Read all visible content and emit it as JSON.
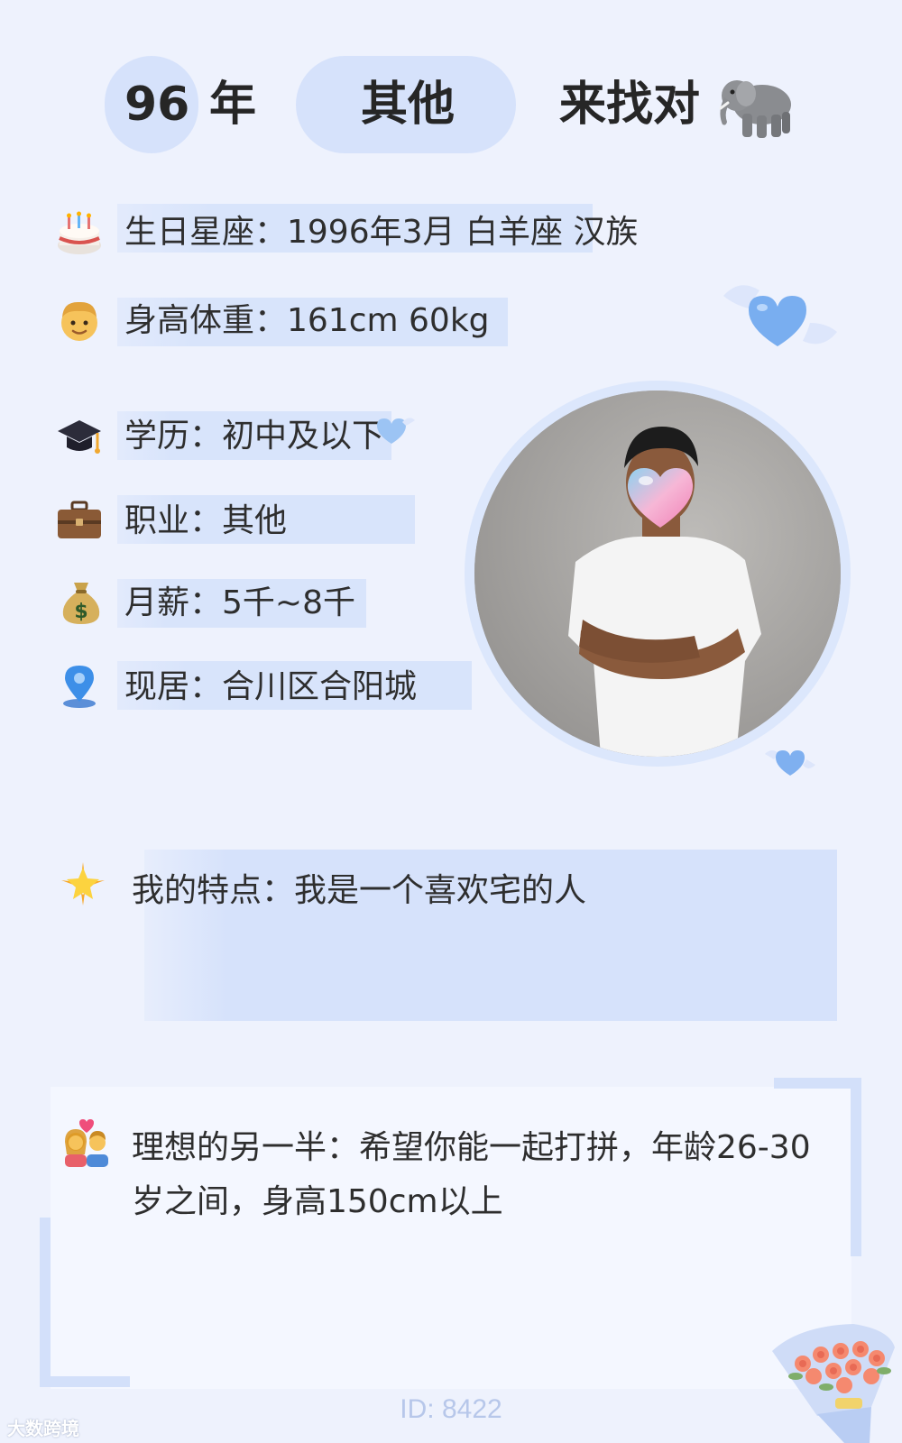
{
  "header": {
    "age_number": "96",
    "age_unit": "年",
    "category": "其他",
    "seeking": "来找对",
    "seeking_icon": "elephant-icon"
  },
  "info": {
    "birthday": {
      "icon": "birthday-cake-icon",
      "text": "生日星座：1996年3月 白羊座 汉族"
    },
    "body": {
      "icon": "man-face-icon",
      "text": "身高体重：161cm 60kg"
    },
    "education": {
      "icon": "graduation-cap-icon",
      "text": "学历：初中及以下"
    },
    "job": {
      "icon": "briefcase-icon",
      "text": "职业：其他"
    },
    "salary": {
      "icon": "money-bag-icon",
      "text": "月薪：5千~8千"
    },
    "location": {
      "icon": "location-pin-icon",
      "text": "现居：合川区合阳城"
    }
  },
  "feature": {
    "icon": "glowing-star-icon",
    "text": "我的特点：我是一个喜欢宅的人"
  },
  "ideal": {
    "icon": "couple-with-heart-icon",
    "text": "理想的另一半：希望你能一起打拼，年龄26-30岁之间，身高150cm以上"
  },
  "footer": {
    "id_text": "ID: 8422"
  },
  "watermark": {
    "text": "大数跨境"
  },
  "colors": {
    "background": "#eef2fd",
    "accent": "#d6e2fb",
    "heart": "#7fb0f0"
  }
}
